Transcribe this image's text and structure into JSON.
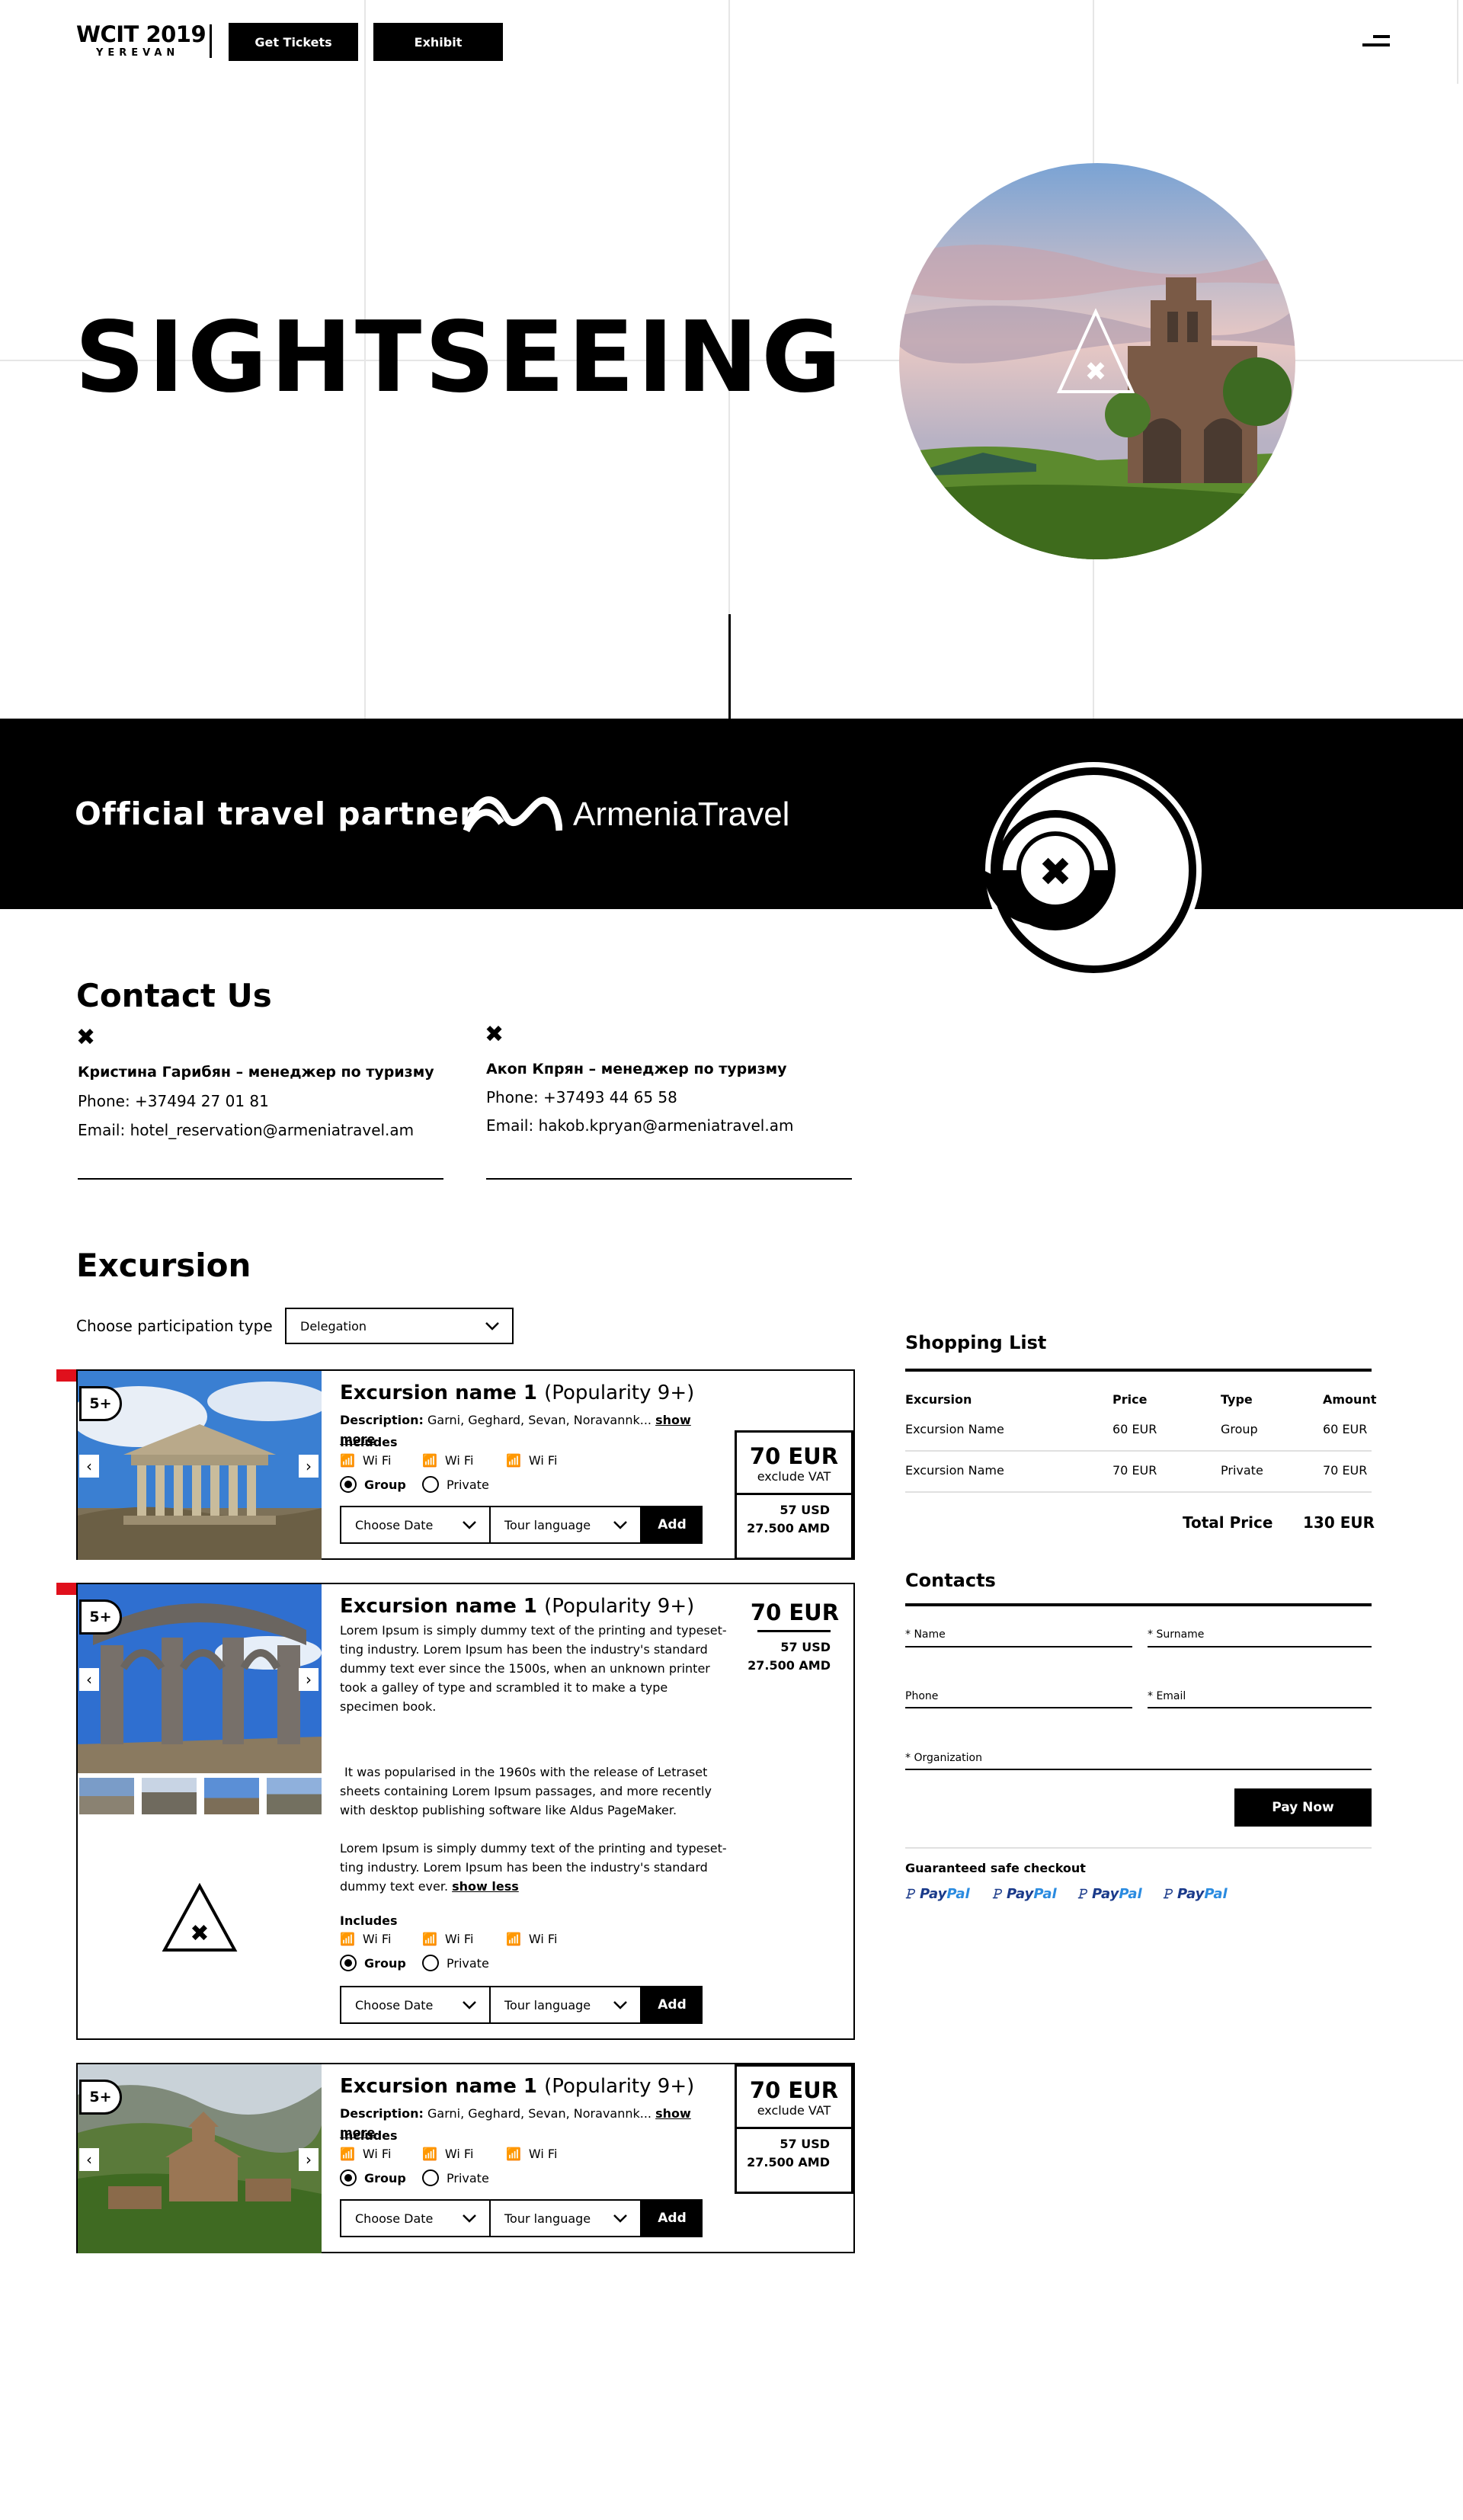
{
  "header": {
    "logo_main": "WCIT 2019",
    "logo_sub": "YEREVAN",
    "get_tickets": "Get Tickets",
    "exhibit": "Exhibit",
    "menu_icon": "hamburger-menu-icon"
  },
  "hero": {
    "title": "SIGHTSEEING"
  },
  "partner": {
    "text": "Official travel partner",
    "brand": "ArmeniaTravel"
  },
  "contact": {
    "title": "Contact Us",
    "people": [
      {
        "name": "Кристина Гарибян – менеджер по туризму",
        "phone": "Phone: +37494 27 01 81",
        "email": "Email: hotel_reservation@armeniatravel.am"
      },
      {
        "name": "Акоп Кпрян – менеджер по туризму",
        "phone": "Phone: +37493 44 65 58",
        "email": "Email: hakob.kpryan@armeniatravel.am"
      }
    ]
  },
  "excursion": {
    "title": "Excursion",
    "participation_label": "Choose participation type",
    "participation_value": "Delegation",
    "cards": [
      {
        "badge": "5+",
        "name": "Excursion name 1",
        "popularity": "(Popularity 9+)",
        "desc_label": "Description:",
        "desc": "Garni, Geghard, Sevan, Noravannk...",
        "show_more": "show more",
        "includes": "Includes",
        "amenities": [
          "Wi Fi",
          "Wi Fi",
          "Wi Fi"
        ],
        "group": "Group",
        "private": "Private",
        "date": "Choose Date",
        "lang": "Tour language",
        "add": "Add",
        "price_eur": "70 EUR",
        "vat": "exclude VAT",
        "price_usd": "57 USD",
        "price_amd": "27.500 AMD"
      },
      {
        "badge": "5+",
        "name": "Excursion name 1",
        "popularity": "(Popularity 9+)",
        "para1": "Lorem Ipsum is simply dummy text of the printing and typeset-ting industry. Lorem Ipsum has been the industry's standard dummy text ever since the 1500s, when an unknown printer took a galley of type and scrambled it to make a type specimen book.",
        "para2": "It was popularised in the 1960s with the release of Letraset sheets containing Lorem Ipsum passages, and more recently with desktop publishing software like Aldus PageMaker.",
        "para3": "Lorem Ipsum is simply dummy text of the printing and typeset-ting industry. Lorem Ipsum has been the industry's standard dummy text ever.",
        "show_less": "show less",
        "includes": "Includes",
        "amenities": [
          "Wi Fi",
          "Wi Fi",
          "Wi Fi"
        ],
        "group": "Group",
        "private": "Private",
        "date": "Choose Date",
        "lang": "Tour language",
        "add": "Add",
        "price_eur": "70 EUR",
        "price_usd": "57 USD",
        "price_amd": "27.500 AMD"
      },
      {
        "badge": "5+",
        "name": "Excursion name 1",
        "popularity": "(Popularity 9+)",
        "desc_label": "Description:",
        "desc": "Garni, Geghard, Sevan, Noravannk...",
        "show_more": "show more",
        "includes": "Includes",
        "amenities": [
          "Wi Fi",
          "Wi Fi",
          "Wi Fi"
        ],
        "group": "Group",
        "private": "Private",
        "date": "Choose Date",
        "lang": "Tour language",
        "add": "Add",
        "price_eur": "70 EUR",
        "vat": "exclude VAT",
        "price_usd": "57 USD",
        "price_amd": "27.500 AMD"
      }
    ]
  },
  "shopping": {
    "title": "Shopping List",
    "headers": [
      "Excursion",
      "Price",
      "Type",
      "Amount"
    ],
    "rows": [
      [
        "Excursion Name",
        "60 EUR",
        "Group",
        "60 EUR"
      ],
      [
        "Excursion Name",
        "70 EUR",
        "Private",
        "70 EUR"
      ]
    ],
    "total_label": "Total Price",
    "total_value": "130 EUR"
  },
  "contacts_form": {
    "title": "Contacts",
    "name": "* Name",
    "surname": "* Surname",
    "phone": "Phone",
    "email": "* Email",
    "organization": "* Organization",
    "pay_now": "Pay Now",
    "safe_checkout": "Guaranteed safe checkout",
    "paypal_a": "Pay",
    "paypal_b": "Pal"
  }
}
